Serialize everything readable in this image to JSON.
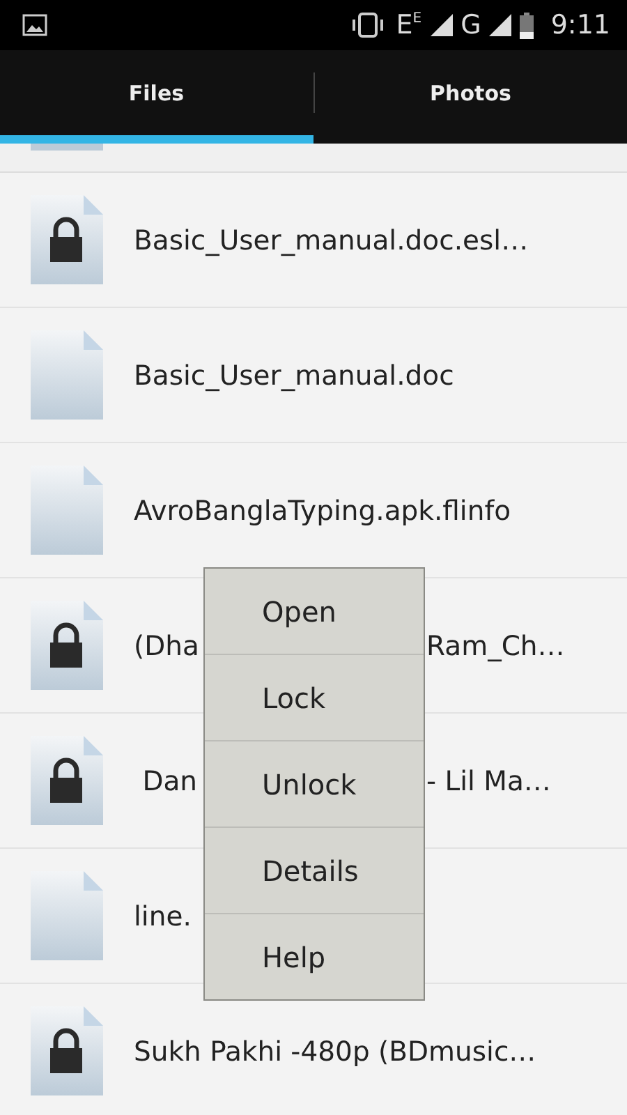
{
  "status_bar": {
    "network": "E$^{E}$",
    "network_2": "G",
    "time": "9:11"
  },
  "tabs": [
    {
      "label": "Files",
      "selected": true
    },
    {
      "label": "Photos",
      "selected": false
    }
  ],
  "files": [
    {
      "kind": "locked",
      "name": "Basic_User_manual.doc.esl…"
    },
    {
      "kind": "plain",
      "name": "Basic_User_manual.doc"
    },
    {
      "kind": "plain",
      "name": "AvroBanglaTyping.apk.flinfo"
    },
    {
      "kind": "locked",
      "name": "(Dha",
      "name_after_menu": "Ram_Ch…"
    },
    {
      "kind": "locked",
      "name": " Dan",
      "name_after_menu": "- Lil Ma…"
    },
    {
      "kind": "plain",
      "name": "line."
    },
    {
      "kind": "locked",
      "name": "Sukh Pakhi -480p (BDmusic…"
    }
  ],
  "context_menu": [
    "Open",
    "Lock",
    "Unlock",
    "Details",
    "Help"
  ]
}
